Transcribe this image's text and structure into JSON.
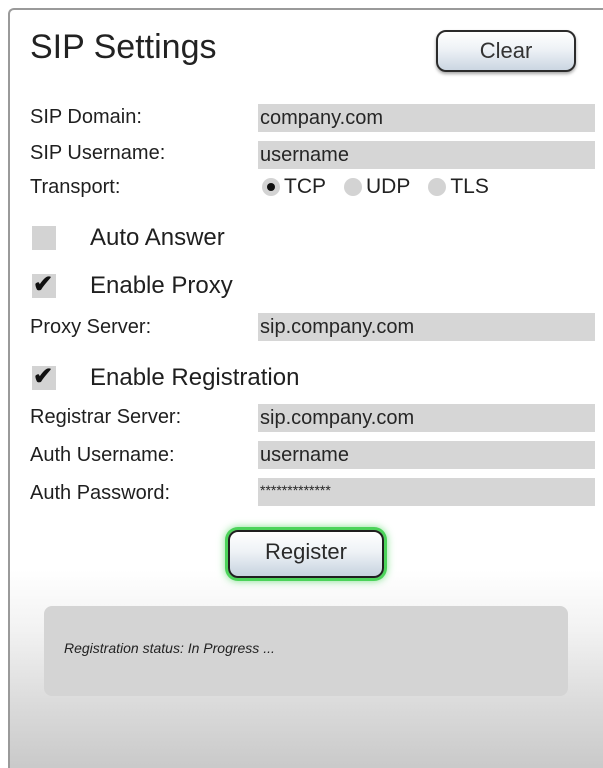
{
  "header": {
    "title": "SIP Settings",
    "clear_label": "Clear"
  },
  "sip": {
    "domain_label": "SIP Domain:",
    "domain_value": "company.com",
    "username_label": "SIP Username:",
    "username_value": "username",
    "transport_label": "Transport:",
    "transport_options": [
      "TCP",
      "UDP",
      "TLS"
    ],
    "transport_selected": "TCP"
  },
  "options": {
    "auto_answer_label": "Auto Answer",
    "auto_answer_checked": false,
    "enable_proxy_label": "Enable Proxy",
    "enable_proxy_checked": true,
    "proxy_server_label": "Proxy Server:",
    "proxy_server_value": "sip.company.com",
    "enable_registration_label": "Enable Registration",
    "enable_registration_checked": true
  },
  "registration": {
    "registrar_label": "Registrar Server:",
    "registrar_value": "sip.company.com",
    "auth_username_label": "Auth Username:",
    "auth_username_value": "username",
    "auth_password_label": "Auth Password:",
    "auth_password_value": "*************",
    "register_label": "Register",
    "status_text": "Registration status: In Progress ..."
  },
  "colors": {
    "button_glow": "#4cd35a",
    "field_bg": "#d6d6d6"
  }
}
